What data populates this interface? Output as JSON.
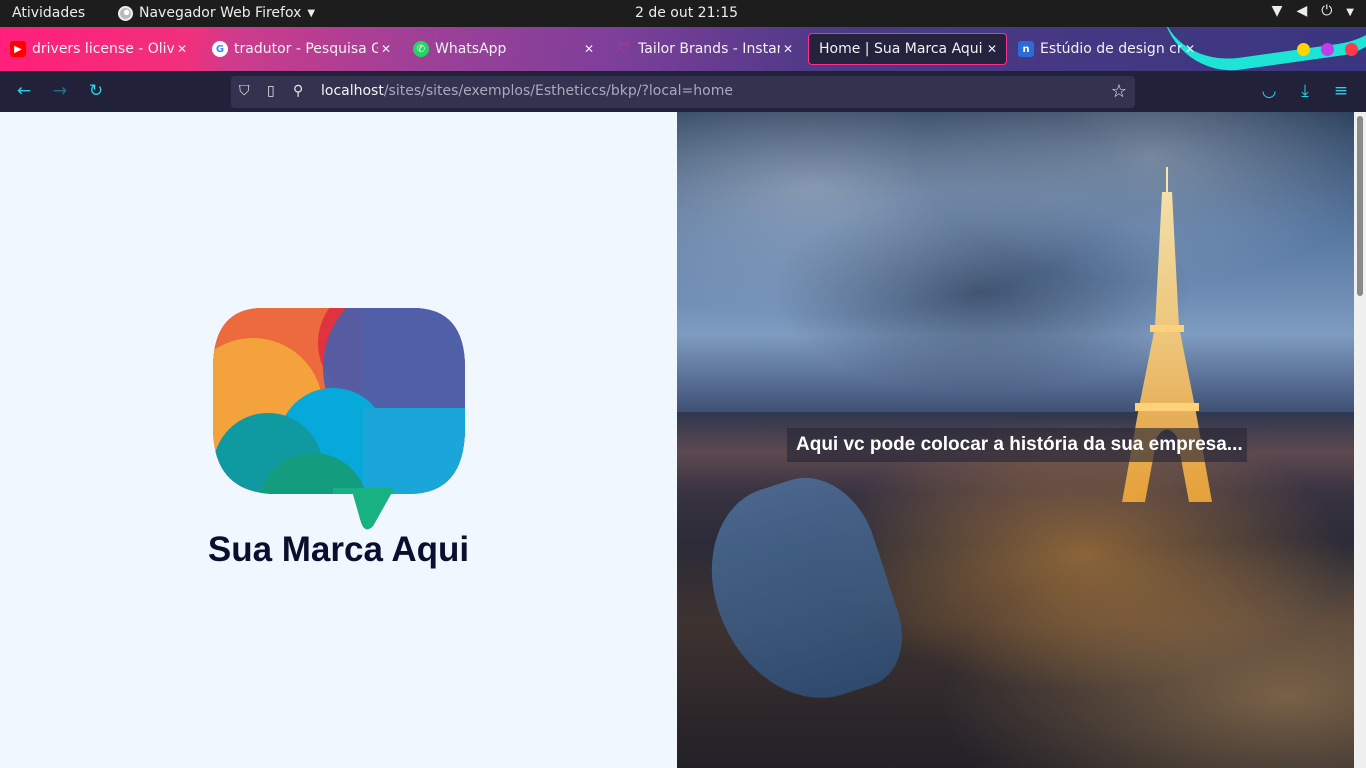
{
  "topbar": {
    "activities": "Atividades",
    "app_name": "Navegador Web Firefox",
    "clock": "2 de out  21:15"
  },
  "tabs": [
    {
      "title": "drivers license - Olivia",
      "favicon": "youtube-icon"
    },
    {
      "title": "tradutor - Pesquisa Go",
      "favicon": "google-icon"
    },
    {
      "title": "WhatsApp",
      "favicon": "whatsapp-icon"
    },
    {
      "title": "Tailor Brands - Instant",
      "favicon": "tailor-brands-icon"
    },
    {
      "title": "Home | Sua Marca Aqui",
      "favicon": "none",
      "active": true
    },
    {
      "title": "Estúdio de design cria",
      "favicon": "n-icon"
    }
  ],
  "navbar": {
    "url_host": "localhost",
    "url_path": "/sites/sites/exemplos/Estheticcs/bkp/?local=home"
  },
  "page": {
    "brand_name": "Sua Marca Aqui",
    "hero_text": "Aqui vc pode colocar a história da sua empresa..."
  },
  "colors": {
    "tab_active_border": "#ff2d8e",
    "nav_icon": "#25d4e6",
    "left_bg": "#f1f7fe",
    "brand_text": "#0b0f2e"
  }
}
